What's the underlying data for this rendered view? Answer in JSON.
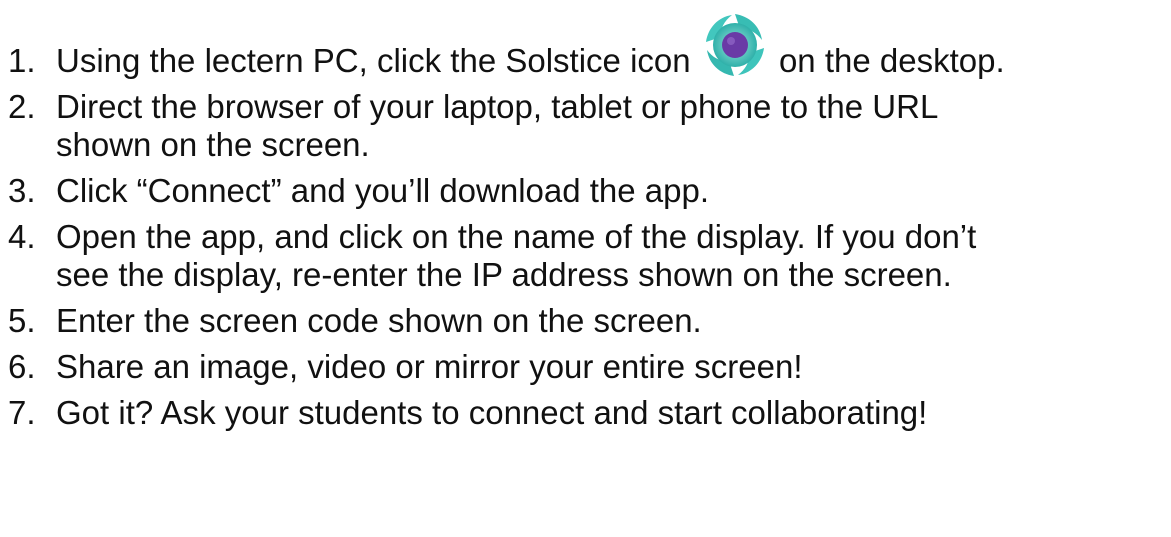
{
  "steps": [
    {
      "number": "1.",
      "before_icon": "Using the lectern PC, click the Solstice icon",
      "icon": "solstice-icon",
      "after_icon": "on the desktop."
    },
    {
      "number": "2.",
      "lines": [
        "Direct the browser of your laptop, tablet or phone to the URL",
        "shown on the screen."
      ]
    },
    {
      "number": "3.",
      "lines": [
        "Click “Connect” and you’ll download the app."
      ]
    },
    {
      "number": "4.",
      "lines": [
        "Open the app, and click on the name of the display.  If you don’t",
        "see the display, re-enter the IP address shown on the screen."
      ]
    },
    {
      "number": "5.",
      "lines": [
        "Enter the screen code shown on the screen."
      ]
    },
    {
      "number": "6.",
      "lines": [
        "Share an image, video or mirror your entire screen!"
      ]
    },
    {
      "number": "7.",
      "lines": [
        "Got it?  Ask your students to connect and start collaborating!"
      ]
    }
  ],
  "colors": {
    "icon_outer": "#40c0b8",
    "icon_inner": "#6a3aa6"
  }
}
